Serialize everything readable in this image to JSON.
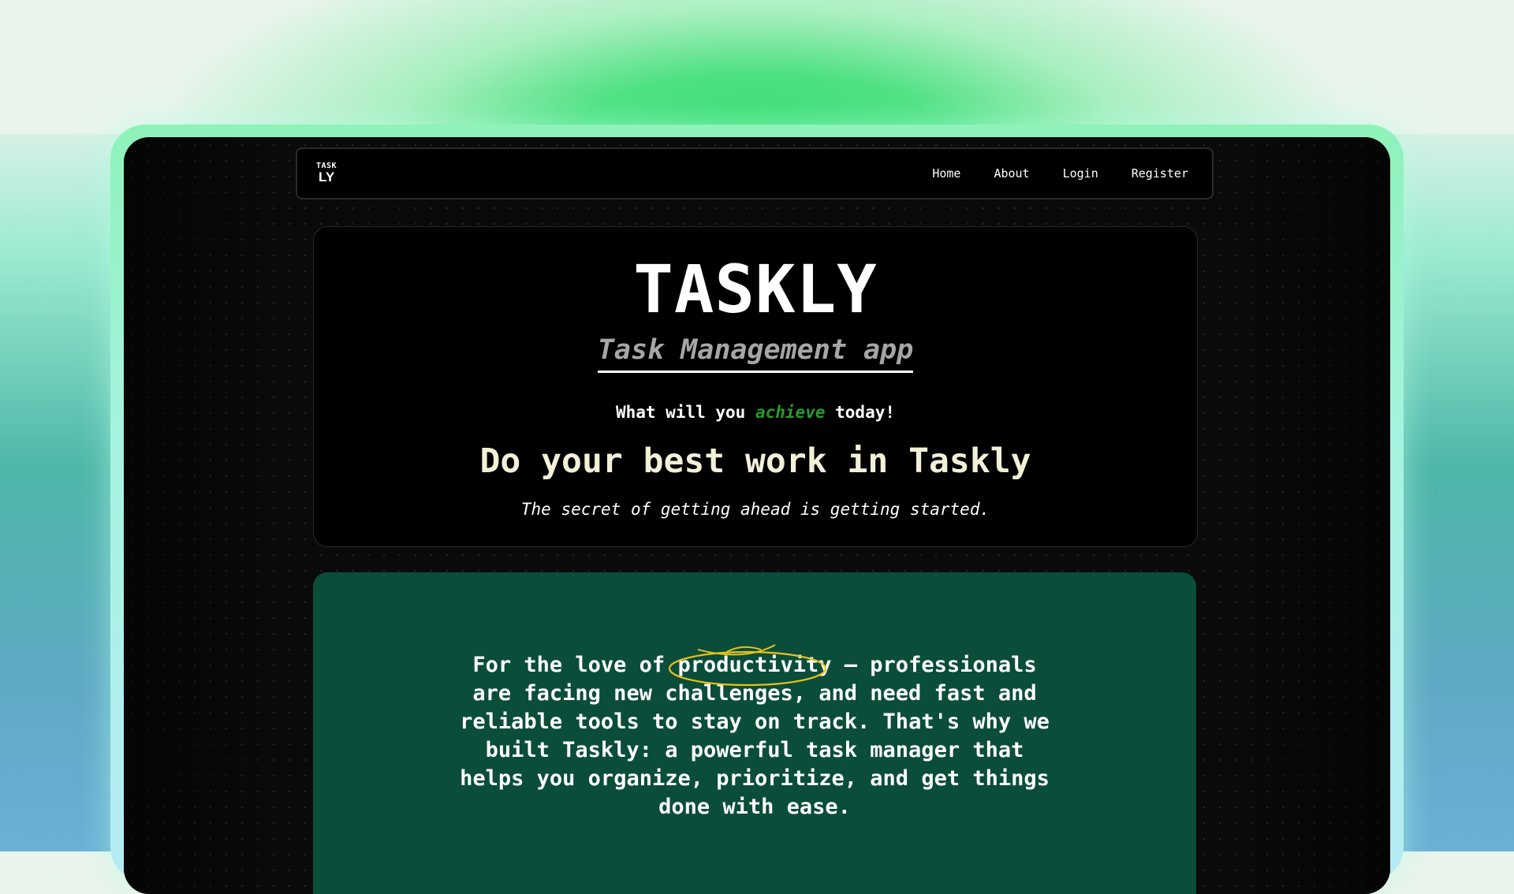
{
  "logo": {
    "top": "TASK",
    "bottom": "LY"
  },
  "nav": {
    "home": "Home",
    "about": "About",
    "login": "Login",
    "register": "Register"
  },
  "hero": {
    "title": "TASKLY",
    "subtitle": "Task Management app",
    "prompt_before": "What will you ",
    "prompt_highlight": "achieve",
    "prompt_after": " today!",
    "headline": "Do your best work in Taskly",
    "quote": "The secret of getting ahead is getting started."
  },
  "about_card": {
    "text_before": "For the love of ",
    "text_highlight": "productivity",
    "text_after": " — professionals are facing new challenges, and need fast and reliable tools to stay on track. That's why we built Taskly: a powerful task manager that helps you organize, prioritize, and get things done with ease."
  },
  "colors": {
    "accent_green": "#2a9a2a",
    "card_green": "#0a4d3a",
    "highlight_yellow": "#e8c11a"
  }
}
